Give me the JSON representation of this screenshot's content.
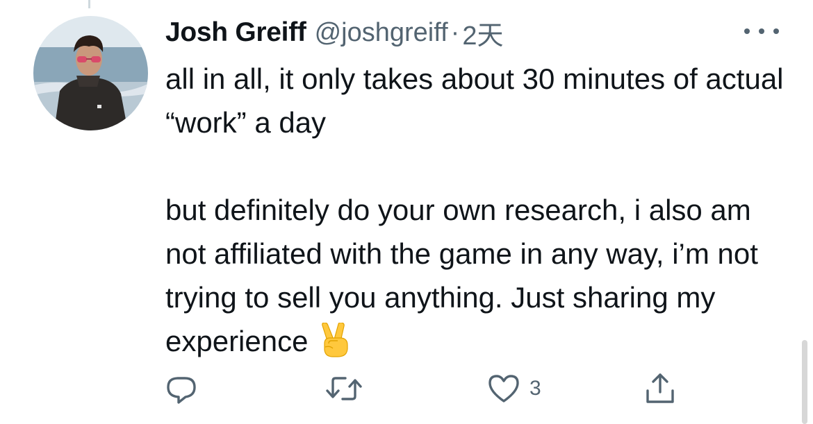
{
  "tweet": {
    "display_name": "Josh Greiff",
    "handle": "@joshgreiff",
    "separator": "·",
    "time": "2天",
    "paragraph_1": "all in all, it only takes about 30 minutes of actual “work” a day",
    "paragraph_2": "but definitely do your own research, i also am not affiliated with the game in any way, i’m not trying to sell you anything. Just sharing my experience",
    "emoji": "✌️"
  },
  "actions": {
    "reply_icon": "reply-icon",
    "retweet_icon": "retweet-icon",
    "like_icon": "heart-icon",
    "like_count": "3",
    "share_icon": "share-icon"
  },
  "colors": {
    "text": "#0f1419",
    "secondary": "#536471",
    "thread_line": "#cfd9de"
  }
}
